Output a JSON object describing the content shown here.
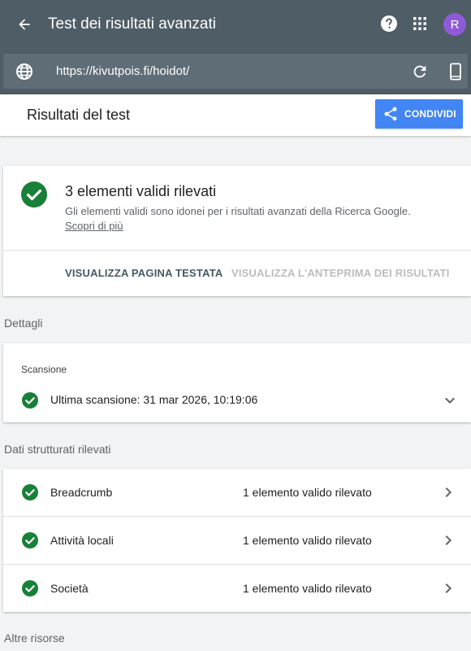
{
  "appbar": {
    "title": "Test dei risultati avanzati",
    "avatar_letter": "R",
    "icons": [
      "arrow-back-icon",
      "help-icon",
      "apps-grid-icon"
    ]
  },
  "urlbar": {
    "url": "https://kivutpois.fi/hoidot/",
    "icons": [
      "globe-icon",
      "reload-icon",
      "smartphone-icon"
    ]
  },
  "subheader": {
    "title": "Risultati del test",
    "share_label": "CONDIVIDI"
  },
  "summary": {
    "title": "3 elementi validi rilevati",
    "description": "Gli elementi validi sono idonei per i risultati avanzati della Ricerca Google.",
    "link": "Scopri di più",
    "actions": {
      "view_page": "VISUALIZZA PAGINA TESTATA",
      "preview": "VISUALIZZA L'ANTEPRIMA DEI RISULTATI"
    }
  },
  "details": {
    "section_label": "Dettagli",
    "scan_title": "Scansione",
    "scan_text": "Ultima scansione: 31 mar 2026, 10:19:06"
  },
  "structured": {
    "section_label": "Dati strutturati rilevati",
    "items": [
      {
        "name": "Breadcrumb",
        "status": "1 elemento valido rilevato"
      },
      {
        "name": "Attività locali",
        "status": "1 elemento valido rilevato"
      },
      {
        "name": "Società",
        "status": "1 elemento valido rilevato"
      }
    ]
  },
  "other": {
    "section_label": "Altre risorse"
  },
  "colors": {
    "appbar": "#4e5d66",
    "urlbar": "#5f6d76",
    "accent": "#4285f4",
    "success": "#188038",
    "avatar": "#8e5ad8"
  }
}
